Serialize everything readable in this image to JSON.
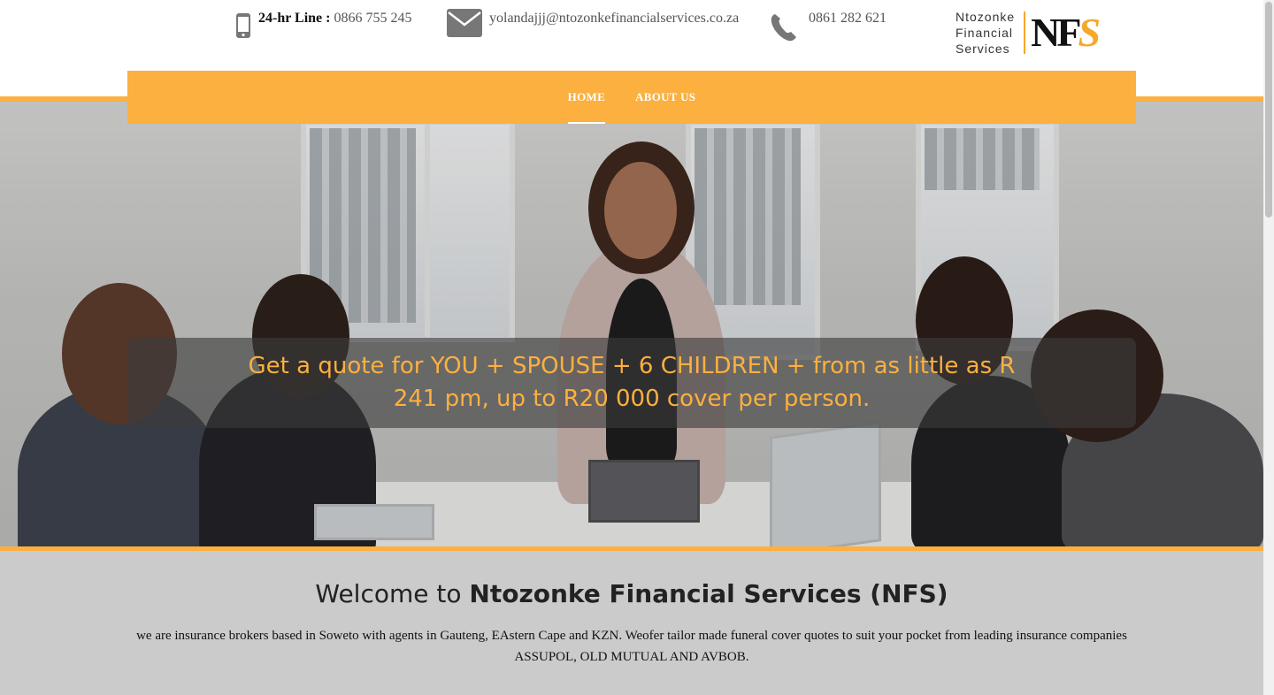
{
  "contact": {
    "line_label": "24-hr Line :",
    "line_number": "0866 755 245",
    "email": "yolandajjj@ntozonkefinancialservices.co.za",
    "phone": "0861 282 621"
  },
  "logo": {
    "line1": "Ntozonke",
    "line2": "Financial",
    "line3": "Services",
    "mark": "NF",
    "mark_s": "S"
  },
  "nav": {
    "items": [
      {
        "label": "HOME",
        "active": true
      },
      {
        "label": "ABOUT US",
        "active": false
      }
    ]
  },
  "hero": {
    "quote": "Get a quote for YOU + SPOUSE + 6 CHILDREN + from as little as R 241 pm, up to R20 000 cover per person."
  },
  "welcome": {
    "title_prefix": "Welcome to ",
    "title_strong": "Ntozonke Financial Services (NFS)",
    "body_line1": "we are insurance brokers based in Soweto with agents in Gauteng, EAstern Cape and KZN. Weofer tailor made funeral cover quotes to suit your pocket from leading insurance companies",
    "body_line2": "ASSUPOL, OLD MUTUAL AND AVBOB."
  },
  "colors": {
    "accent": "#fbb040",
    "text_dark": "#222222",
    "welcome_bg": "#cbcbcb"
  },
  "icons": [
    "mobile-phone-icon",
    "envelope-icon",
    "phone-icon"
  ]
}
